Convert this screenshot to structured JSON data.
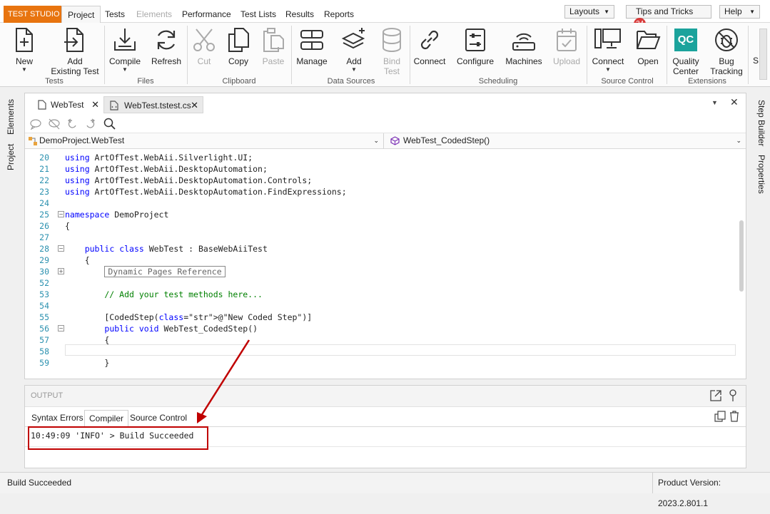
{
  "app": {
    "brand": "TEST STUDIO",
    "menu_tabs": [
      "Project",
      "Tests",
      "Elements",
      "Performance",
      "Test Lists",
      "Results",
      "Reports"
    ],
    "layouts_label": "Layouts",
    "tips_label": "Tips and Tricks",
    "tips_count": "24",
    "help_label": "Help"
  },
  "ribbon": {
    "buttons": {
      "new": "New",
      "add_existing": [
        "Add",
        "Existing Test"
      ],
      "compile": "Compile",
      "refresh": "Refresh",
      "cut": "Cut",
      "copy": "Copy",
      "paste": "Paste",
      "manage": "Manage",
      "add": "Add",
      "bind_test": [
        "Bind",
        "Test"
      ],
      "connect": "Connect",
      "configure": "Configure",
      "machines": "Machines",
      "upload": "Upload",
      "connect_sc": "Connect",
      "open": "Open",
      "quality_center": [
        "Quality",
        "Center"
      ],
      "bug_tracking": [
        "Bug",
        "Tracking"
      ],
      "cut_off": "S"
    },
    "groups": [
      "Tests",
      "Files",
      "Clipboard",
      "Data Sources",
      "Scheduling",
      "Source Control",
      "Extensions"
    ],
    "qc_icon_text": "QC"
  },
  "side_tabs": {
    "left": [
      "Elements",
      "Project"
    ],
    "right": [
      "Step Builder",
      "Properties"
    ]
  },
  "document": {
    "tabs": [
      "WebTest",
      "WebTest.tstest.cs"
    ],
    "class_combo": "DemoProject.WebTest",
    "method_combo": "WebTest_CodedStep()",
    "code_lines": [
      {
        "n": "20",
        "text": "using ArtOfTest.WebAii.Silverlight.UI;"
      },
      {
        "n": "21",
        "text": "using ArtOfTest.WebAii.DesktopAutomation;"
      },
      {
        "n": "22",
        "text": "using ArtOfTest.WebAii.DesktopAutomation.Controls;"
      },
      {
        "n": "23",
        "text": "using ArtOfTest.WebAii.DesktopAutomation.FindExpressions;"
      },
      {
        "n": "24",
        "text": ""
      },
      {
        "n": "25",
        "text": "namespace DemoProject"
      },
      {
        "n": "26",
        "text": "{"
      },
      {
        "n": "27",
        "text": ""
      },
      {
        "n": "28",
        "text": "    public class WebTest : BaseWebAiiTest"
      },
      {
        "n": "29",
        "text": "    {"
      },
      {
        "n": "30",
        "text": "Dynamic Pages Reference"
      },
      {
        "n": "52",
        "text": ""
      },
      {
        "n": "53",
        "text": "        // Add your test methods here..."
      },
      {
        "n": "54",
        "text": ""
      },
      {
        "n": "55",
        "text": "        [CodedStep(@\"New Coded Step\")]"
      },
      {
        "n": "56",
        "text": "        public void WebTest_CodedStep()"
      },
      {
        "n": "57",
        "text": "        {"
      },
      {
        "n": "58",
        "text": ""
      },
      {
        "n": "59",
        "text": "        }"
      }
    ]
  },
  "output": {
    "title": "OUTPUT",
    "tabs": [
      "Syntax Errors",
      "Compiler",
      "Source Control"
    ],
    "message": "10:49:09 'INFO' > Build Succeeded"
  },
  "status": {
    "left": "Build Succeeded",
    "right": "Product Version: 2023.2.801.1"
  },
  "colors": {
    "brand": "#e8740f",
    "keyword": "#0000ff",
    "comment": "#008000",
    "string": "#a31515",
    "line_number": "#2b91af",
    "annotation": "#c00000",
    "qc": "#1ba39c"
  }
}
